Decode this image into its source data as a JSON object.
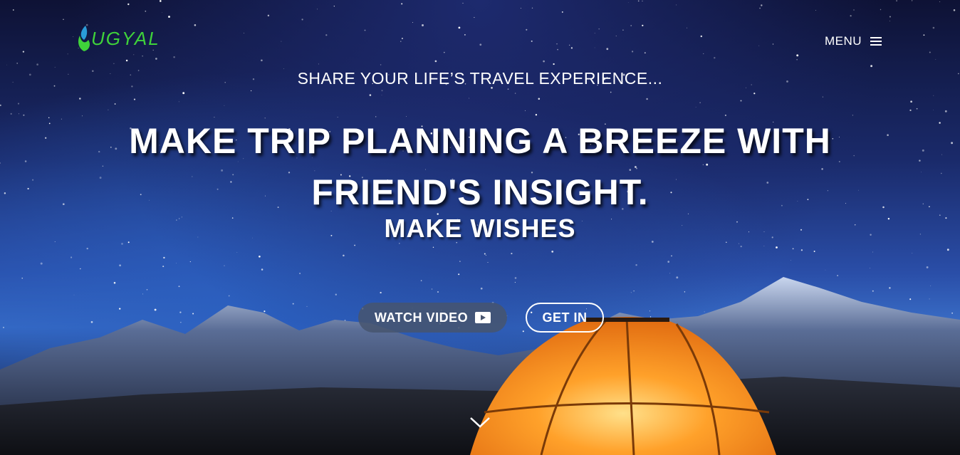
{
  "brand": {
    "name": "UGYAL",
    "color": "#3fd23a"
  },
  "nav": {
    "menu_label": "MENU",
    "menu_icon": "hamburger-icon"
  },
  "hero": {
    "tagline": "SHARE YOUR LIFE’S TRAVEL EXPERIENCE...",
    "headline": "MAKE TRIP PLANNING A BREEZE WITH FRIEND'S INSIGHT.",
    "subheadline": "MAKE WISHES",
    "watch_video_label": "WATCH VIDEO",
    "watch_video_icon": "play-icon",
    "get_in_label": "GET IN",
    "scroll_icon": "chevron-down-icon"
  },
  "colors": {
    "tent": "#ff8a1a",
    "sky": "#1a2a6a"
  }
}
